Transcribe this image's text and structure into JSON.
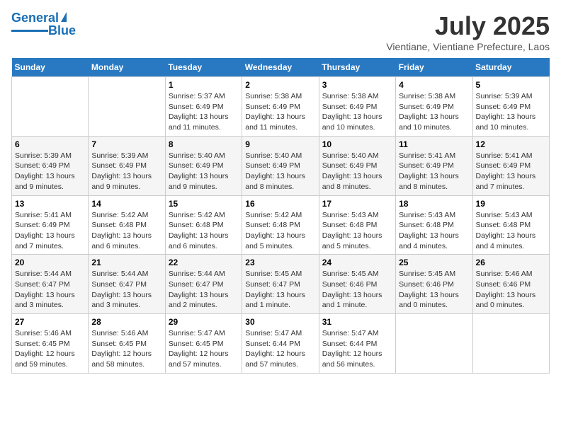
{
  "header": {
    "logo_line1": "General",
    "logo_line2": "Blue",
    "title": "July 2025",
    "location": "Vientiane, Vientiane Prefecture, Laos"
  },
  "days_of_week": [
    "Sunday",
    "Monday",
    "Tuesday",
    "Wednesday",
    "Thursday",
    "Friday",
    "Saturday"
  ],
  "weeks": [
    [
      {
        "day": "",
        "info": ""
      },
      {
        "day": "",
        "info": ""
      },
      {
        "day": "1",
        "info": "Sunrise: 5:37 AM\nSunset: 6:49 PM\nDaylight: 13 hours and 11 minutes."
      },
      {
        "day": "2",
        "info": "Sunrise: 5:38 AM\nSunset: 6:49 PM\nDaylight: 13 hours and 11 minutes."
      },
      {
        "day": "3",
        "info": "Sunrise: 5:38 AM\nSunset: 6:49 PM\nDaylight: 13 hours and 10 minutes."
      },
      {
        "day": "4",
        "info": "Sunrise: 5:38 AM\nSunset: 6:49 PM\nDaylight: 13 hours and 10 minutes."
      },
      {
        "day": "5",
        "info": "Sunrise: 5:39 AM\nSunset: 6:49 PM\nDaylight: 13 hours and 10 minutes."
      }
    ],
    [
      {
        "day": "6",
        "info": "Sunrise: 5:39 AM\nSunset: 6:49 PM\nDaylight: 13 hours and 9 minutes."
      },
      {
        "day": "7",
        "info": "Sunrise: 5:39 AM\nSunset: 6:49 PM\nDaylight: 13 hours and 9 minutes."
      },
      {
        "day": "8",
        "info": "Sunrise: 5:40 AM\nSunset: 6:49 PM\nDaylight: 13 hours and 9 minutes."
      },
      {
        "day": "9",
        "info": "Sunrise: 5:40 AM\nSunset: 6:49 PM\nDaylight: 13 hours and 8 minutes."
      },
      {
        "day": "10",
        "info": "Sunrise: 5:40 AM\nSunset: 6:49 PM\nDaylight: 13 hours and 8 minutes."
      },
      {
        "day": "11",
        "info": "Sunrise: 5:41 AM\nSunset: 6:49 PM\nDaylight: 13 hours and 8 minutes."
      },
      {
        "day": "12",
        "info": "Sunrise: 5:41 AM\nSunset: 6:49 PM\nDaylight: 13 hours and 7 minutes."
      }
    ],
    [
      {
        "day": "13",
        "info": "Sunrise: 5:41 AM\nSunset: 6:49 PM\nDaylight: 13 hours and 7 minutes."
      },
      {
        "day": "14",
        "info": "Sunrise: 5:42 AM\nSunset: 6:48 PM\nDaylight: 13 hours and 6 minutes."
      },
      {
        "day": "15",
        "info": "Sunrise: 5:42 AM\nSunset: 6:48 PM\nDaylight: 13 hours and 6 minutes."
      },
      {
        "day": "16",
        "info": "Sunrise: 5:42 AM\nSunset: 6:48 PM\nDaylight: 13 hours and 5 minutes."
      },
      {
        "day": "17",
        "info": "Sunrise: 5:43 AM\nSunset: 6:48 PM\nDaylight: 13 hours and 5 minutes."
      },
      {
        "day": "18",
        "info": "Sunrise: 5:43 AM\nSunset: 6:48 PM\nDaylight: 13 hours and 4 minutes."
      },
      {
        "day": "19",
        "info": "Sunrise: 5:43 AM\nSunset: 6:48 PM\nDaylight: 13 hours and 4 minutes."
      }
    ],
    [
      {
        "day": "20",
        "info": "Sunrise: 5:44 AM\nSunset: 6:47 PM\nDaylight: 13 hours and 3 minutes."
      },
      {
        "day": "21",
        "info": "Sunrise: 5:44 AM\nSunset: 6:47 PM\nDaylight: 13 hours and 3 minutes."
      },
      {
        "day": "22",
        "info": "Sunrise: 5:44 AM\nSunset: 6:47 PM\nDaylight: 13 hours and 2 minutes."
      },
      {
        "day": "23",
        "info": "Sunrise: 5:45 AM\nSunset: 6:47 PM\nDaylight: 13 hours and 1 minute."
      },
      {
        "day": "24",
        "info": "Sunrise: 5:45 AM\nSunset: 6:46 PM\nDaylight: 13 hours and 1 minute."
      },
      {
        "day": "25",
        "info": "Sunrise: 5:45 AM\nSunset: 6:46 PM\nDaylight: 13 hours and 0 minutes."
      },
      {
        "day": "26",
        "info": "Sunrise: 5:46 AM\nSunset: 6:46 PM\nDaylight: 13 hours and 0 minutes."
      }
    ],
    [
      {
        "day": "27",
        "info": "Sunrise: 5:46 AM\nSunset: 6:45 PM\nDaylight: 12 hours and 59 minutes."
      },
      {
        "day": "28",
        "info": "Sunrise: 5:46 AM\nSunset: 6:45 PM\nDaylight: 12 hours and 58 minutes."
      },
      {
        "day": "29",
        "info": "Sunrise: 5:47 AM\nSunset: 6:45 PM\nDaylight: 12 hours and 57 minutes."
      },
      {
        "day": "30",
        "info": "Sunrise: 5:47 AM\nSunset: 6:44 PM\nDaylight: 12 hours and 57 minutes."
      },
      {
        "day": "31",
        "info": "Sunrise: 5:47 AM\nSunset: 6:44 PM\nDaylight: 12 hours and 56 minutes."
      },
      {
        "day": "",
        "info": ""
      },
      {
        "day": "",
        "info": ""
      }
    ]
  ]
}
